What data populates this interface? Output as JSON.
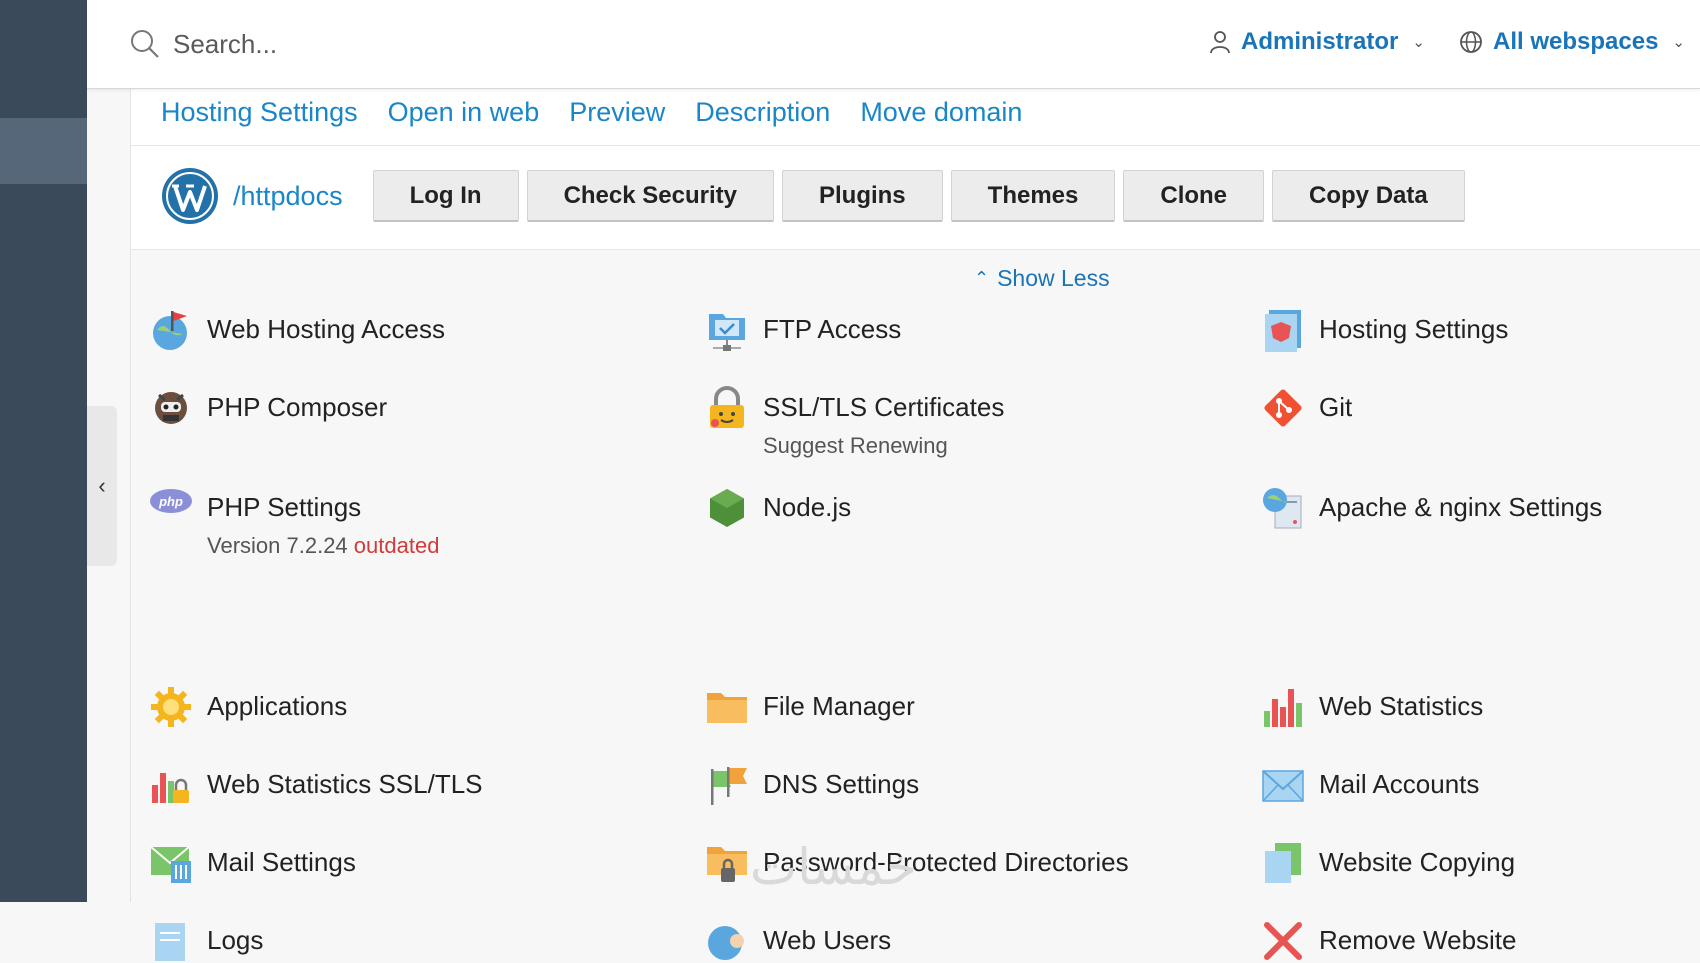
{
  "search": {
    "placeholder": "Search..."
  },
  "header": {
    "user": "Administrator",
    "webspace": "All webspaces"
  },
  "tabs": [
    "Hosting Settings",
    "Open in web",
    "Preview",
    "Description",
    "Move domain"
  ],
  "wordpress": {
    "path": "/httpdocs",
    "buttons": [
      "Log In",
      "Check Security",
      "Plugins",
      "Themes",
      "Clone",
      "Copy Data"
    ]
  },
  "show_less": "Show Less",
  "tools": {
    "web_hosting_access": "Web Hosting Access",
    "ftp_access": "FTP Access",
    "hosting_settings": "Hosting Settings",
    "php_composer": "PHP Composer",
    "ssl_tls": "SSL/TLS Certificates",
    "ssl_tls_sub": "Suggest Renewing",
    "git": "Git",
    "php_settings": "PHP Settings",
    "php_version": "Version 7.2.24",
    "php_outdated": "outdated",
    "nodejs": "Node.js",
    "apache_nginx": "Apache & nginx Settings",
    "applications": "Applications",
    "file_manager": "File Manager",
    "web_statistics": "Web Statistics",
    "web_statistics_ssl": "Web Statistics SSL/TLS",
    "dns_settings": "DNS Settings",
    "mail_accounts": "Mail Accounts",
    "mail_settings": "Mail Settings",
    "password_dirs": "Password-Protected Directories",
    "website_copying": "Website Copying",
    "logs": "Logs",
    "web_users": "Web Users",
    "remove_website": "Remove Website"
  },
  "watermark": "خمسات",
  "colors": {
    "sidebar": "#3a4a5b",
    "link": "#1a86c8",
    "warning": "#e07c13",
    "danger": "#d13b3b"
  }
}
